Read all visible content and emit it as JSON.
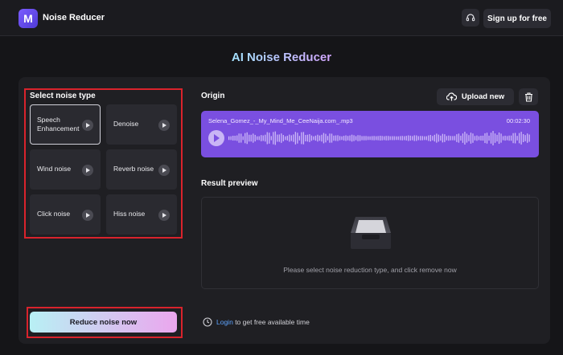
{
  "app": {
    "name": "Noise Reducer",
    "logo_letter": "M",
    "brand_color": "#6c4ff0"
  },
  "header": {
    "signup_label": "Sign up for free",
    "support_icon": "headset-icon"
  },
  "page": {
    "title": "AI Noise Reducer"
  },
  "noise_panel": {
    "heading": "Select noise type",
    "selected": "Speech Enhancement",
    "types": [
      {
        "line1": "Speech",
        "line2": "Enhancement"
      },
      {
        "line1": "Denoise",
        "line2": ""
      },
      {
        "line1": "Wind noise",
        "line2": ""
      },
      {
        "line1": "Reverb noise",
        "line2": ""
      },
      {
        "line1": "Click noise",
        "line2": ""
      },
      {
        "line1": "Hiss noise",
        "line2": ""
      }
    ],
    "reduce_label": "Reduce noise now"
  },
  "origin": {
    "heading": "Origin",
    "upload_label": "Upload new",
    "file_name": "Selena_Gomez_-_My_Mind_Me_CeeNaija.com_.mp3",
    "duration": "00:02:30",
    "player_color": "#7a4fe0"
  },
  "result": {
    "heading": "Result preview",
    "message": "Please select noise reduction type, and click remove now"
  },
  "footer": {
    "login_link": "Login",
    "login_text": "to get free available time"
  },
  "annotation_color": "#d9232c"
}
